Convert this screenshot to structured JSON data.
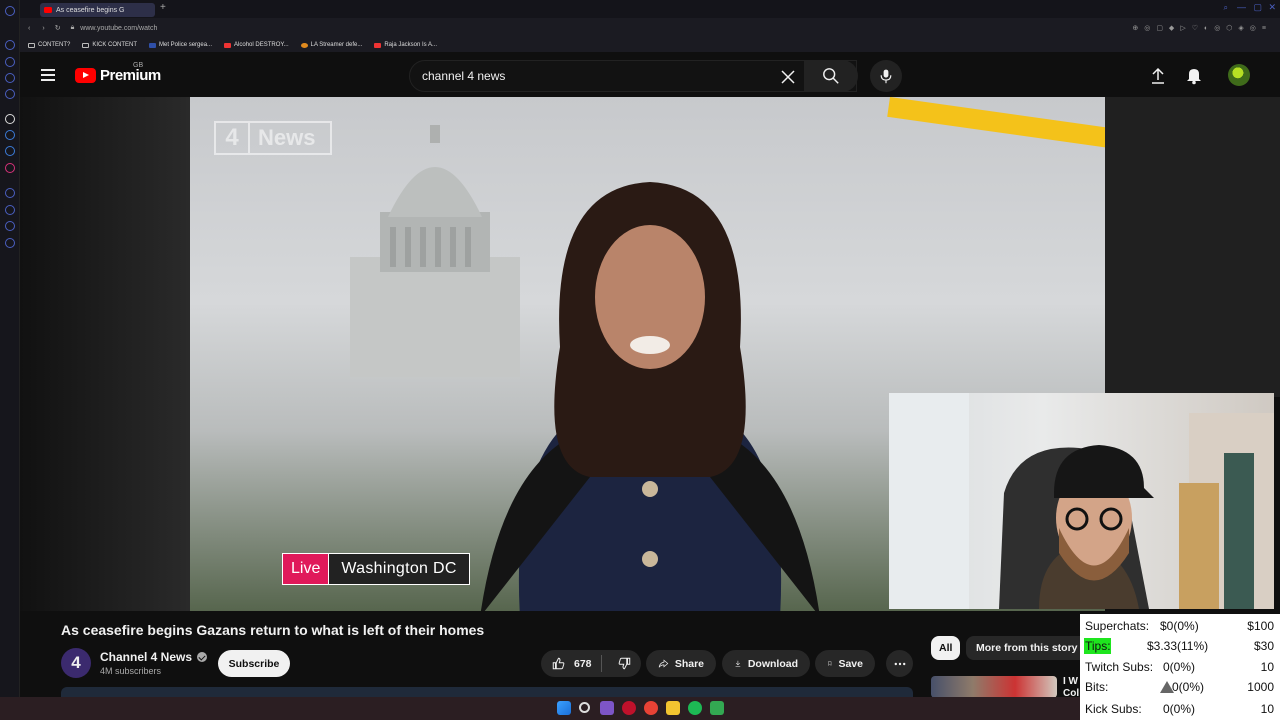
{
  "browser": {
    "tab_title": "As ceasefire begins G",
    "url": "www.youtube.com/watch",
    "bookmarks": [
      {
        "label": "CONTENT?",
        "icon": "folder-icon"
      },
      {
        "label": "KICK CONTENT",
        "icon": "folder-icon"
      },
      {
        "label": "Met Police sergea...",
        "icon": "site-icon"
      },
      {
        "label": "Alcohol DESTROY...",
        "icon": "youtube-icon"
      },
      {
        "label": "LA Streamer defe...",
        "icon": "site-icon"
      },
      {
        "label": "Raja Jackson Is A...",
        "icon": "youtube-icon"
      }
    ]
  },
  "header": {
    "logo_text": "Premium",
    "country_code": "GB",
    "search_value": "channel 4 news"
  },
  "video": {
    "watermark_number": "4",
    "watermark_text": "News",
    "live_label": "Live",
    "location_label": "Washington DC",
    "title": "As ceasefire begins Gazans return to what is left of their homes"
  },
  "channel": {
    "avatar_glyph": "4",
    "name": "Channel 4 News",
    "subscribers": "4M subscribers",
    "subscribe_label": "Subscribe"
  },
  "actions": {
    "like_count": "678",
    "share_label": "Share",
    "download_label": "Download",
    "save_label": "Save"
  },
  "chips": {
    "all_label": "All",
    "more_label": "More from this story"
  },
  "recommendation": {
    "title_fragment": "I W Col"
  },
  "stream_stats": [
    {
      "label": "Superchats:",
      "value": "$0(0%)",
      "goal": "$100"
    },
    {
      "label": "Tips:",
      "value": "$3.33(11%)",
      "goal": "$30"
    },
    {
      "label": "Twitch Subs:",
      "value": "0(0%)",
      "goal": "10"
    },
    {
      "label": "Bits:",
      "value": "0(0%)",
      "goal": "1000"
    },
    {
      "label": "Kick Subs:",
      "value": "0(0%)",
      "goal": "10"
    }
  ],
  "colors": {
    "youtube_red": "#ff0000",
    "live_pink": "#e0195a",
    "tips_highlight": "#1ee51e"
  }
}
